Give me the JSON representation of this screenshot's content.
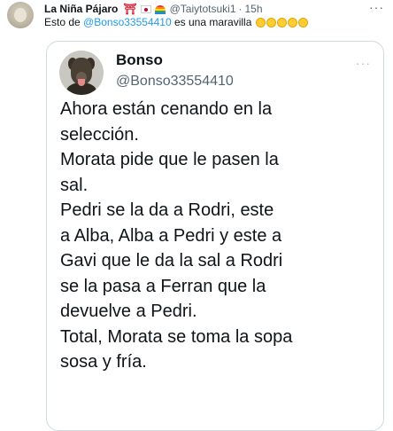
{
  "outer_tweet": {
    "author_name": "La Niña Pájaro",
    "emoji_icons": [
      "torii-gate-icon",
      "japan-flag-icon",
      "rainbow-flag-icon"
    ],
    "handle": "@Taiytotsuki1",
    "separator": "·",
    "time": "15h",
    "text_prefix": "Esto de",
    "mention": "@Bonso33554410",
    "text_suffix": "es una maravilla",
    "laugh_emoji_count": 5,
    "more_label": "···"
  },
  "quoted_tweet": {
    "author_name": "Bonso",
    "handle": "@Bonso33554410",
    "more_label": "···",
    "lines": [
      "Ahora están cenando en la",
      "selección.",
      "Morata pide que le pasen la",
      "sal.",
      "Pedri se la da a Rodri, este",
      "a Alba, Alba a Pedri y este a",
      "Gavi que le da la sal a Rodri",
      "se la pasa a Ferran que la",
      "devuelve a Pedri.",
      "Total, Morata se toma la sopa",
      "sosa y fría."
    ]
  },
  "colors": {
    "link": "#1d9bf0",
    "secondary_text": "#536471",
    "border": "#cfd9de"
  }
}
